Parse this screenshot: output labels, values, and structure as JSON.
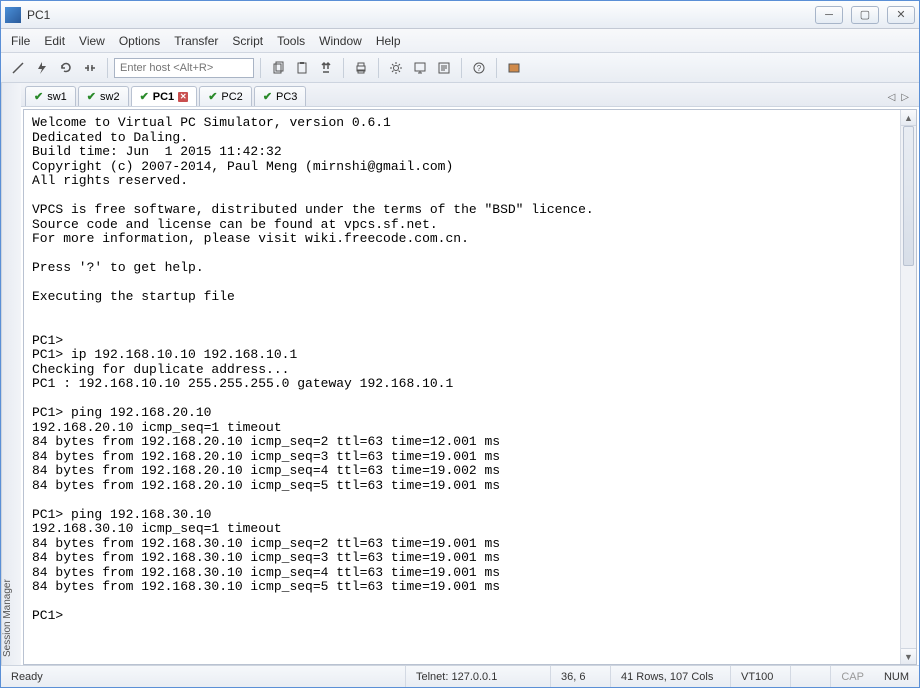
{
  "window": {
    "title": "PC1"
  },
  "menu": {
    "file": "File",
    "edit": "Edit",
    "view": "View",
    "options": "Options",
    "transfer": "Transfer",
    "script": "Script",
    "tools": "Tools",
    "window": "Window",
    "help": "Help"
  },
  "toolbar": {
    "host_placeholder": "Enter host <Alt+R>"
  },
  "sidebar": {
    "label": "Session Manager"
  },
  "tabs": [
    {
      "label": "sw1",
      "active": false,
      "closable": false
    },
    {
      "label": "sw2",
      "active": false,
      "closable": false
    },
    {
      "label": "PC1",
      "active": true,
      "closable": true
    },
    {
      "label": "PC2",
      "active": false,
      "closable": false
    },
    {
      "label": "PC3",
      "active": false,
      "closable": false
    }
  ],
  "terminal": {
    "text": "Welcome to Virtual PC Simulator, version 0.6.1\nDedicated to Daling.\nBuild time: Jun  1 2015 11:42:32\nCopyright (c) 2007-2014, Paul Meng (mirnshi@gmail.com)\nAll rights reserved.\n\nVPCS is free software, distributed under the terms of the \"BSD\" licence.\nSource code and license can be found at vpcs.sf.net.\nFor more information, please visit wiki.freecode.com.cn.\n\nPress '?' to get help.\n\nExecuting the startup file\n\n\nPC1>\nPC1> ip 192.168.10.10 192.168.10.1\nChecking for duplicate address...\nPC1 : 192.168.10.10 255.255.255.0 gateway 192.168.10.1\n\nPC1> ping 192.168.20.10\n192.168.20.10 icmp_seq=1 timeout\n84 bytes from 192.168.20.10 icmp_seq=2 ttl=63 time=12.001 ms\n84 bytes from 192.168.20.10 icmp_seq=3 ttl=63 time=19.001 ms\n84 bytes from 192.168.20.10 icmp_seq=4 ttl=63 time=19.002 ms\n84 bytes from 192.168.20.10 icmp_seq=5 ttl=63 time=19.001 ms\n\nPC1> ping 192.168.30.10\n192.168.30.10 icmp_seq=1 timeout\n84 bytes from 192.168.30.10 icmp_seq=2 ttl=63 time=19.001 ms\n84 bytes from 192.168.30.10 icmp_seq=3 ttl=63 time=19.001 ms\n84 bytes from 192.168.30.10 icmp_seq=4 ttl=63 time=19.001 ms\n84 bytes from 192.168.30.10 icmp_seq=5 ttl=63 time=19.001 ms\n\nPC1>"
  },
  "status": {
    "ready": "Ready",
    "connection": "Telnet: 127.0.0.1",
    "cursor": "36,   6",
    "size": "41 Rows, 107 Cols",
    "emulation": "VT100",
    "caps": "CAP",
    "num": "NUM"
  }
}
